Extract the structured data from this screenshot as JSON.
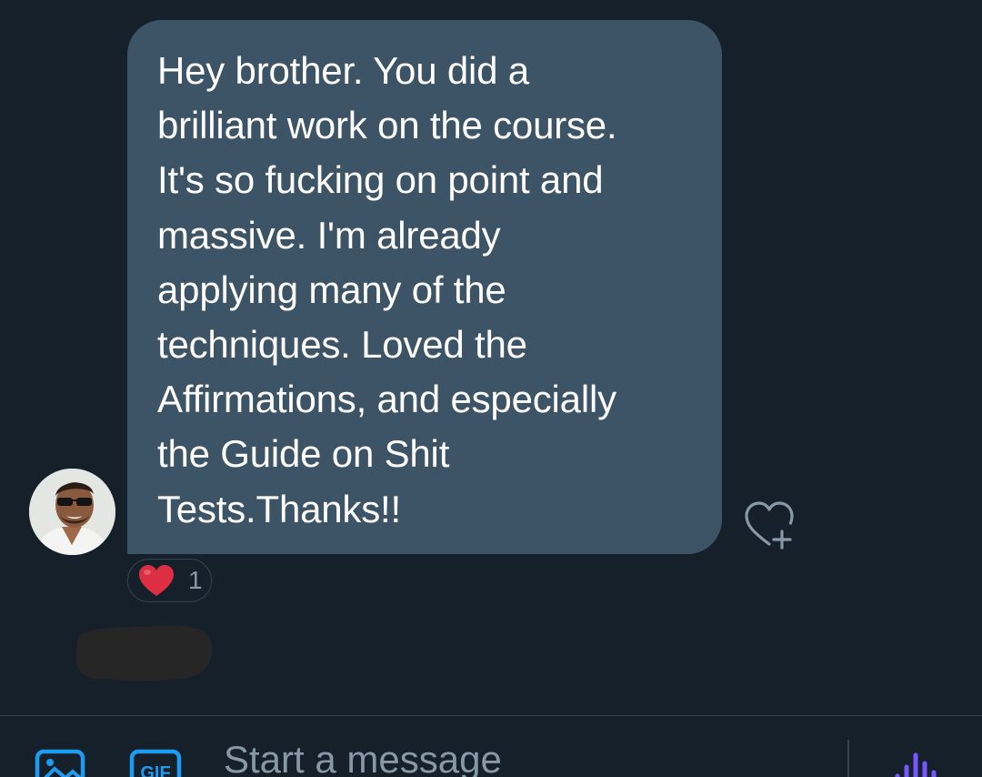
{
  "message": {
    "text": "Hey brother. You did a\nbrilliant work on the course.\nIt's so fucking on point and\nmassive. I'm already\napplying many of the\ntechniques. Loved the\nAffirmations, and especially\nthe Guide on Shit\nTests.Thanks!!",
    "reactions": [
      {
        "emoji": "red-heart",
        "count": "1"
      }
    ]
  },
  "composer": {
    "placeholder": "Start a message"
  },
  "icons": {
    "add_reaction": "heart-plus-icon",
    "media": "image-icon",
    "gif": "gif-icon",
    "voice": "voice-message-icon"
  },
  "colors": {
    "background": "#15202b",
    "bubble": "#3d5466",
    "accent": "#1d9bf0",
    "voice_accent": "#7856ff",
    "reaction_heart": "#e0245e",
    "muted_text": "#8899a6"
  }
}
